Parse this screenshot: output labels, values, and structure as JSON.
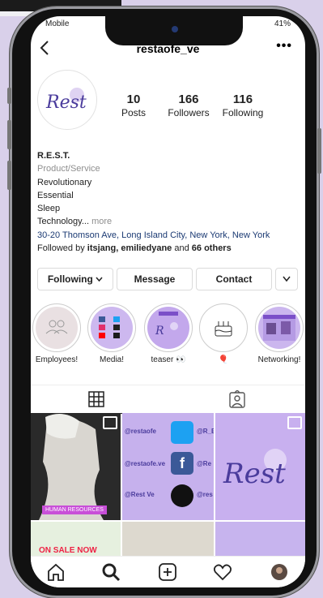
{
  "status": {
    "carrier": "Mobile",
    "battery": "41%"
  },
  "header": {
    "username": "restaofe_ve",
    "back_icon": "back-arrow-icon",
    "options_icon": "more-options-icon",
    "options_label": "•••"
  },
  "profile": {
    "logo_text": "Rest",
    "stats": [
      {
        "value": "10",
        "label": "Posts"
      },
      {
        "value": "166",
        "label": "Followers"
      },
      {
        "value": "116",
        "label": "Following"
      }
    ],
    "name": "R.E.S.T.",
    "category": "Product/Service",
    "bio_lines": [
      "Revolutionary",
      "Essential",
      "Sleep"
    ],
    "bio_truncated": "Technology...",
    "more_label": "more",
    "address": "30-20 Thomson Ave, Long Island City, New York, New York",
    "followed_prefix": "Followed by",
    "followed_names": "itsjang, emiliedyane",
    "followed_and": "and",
    "followed_others": "66 others"
  },
  "actions": {
    "following": "Following",
    "message": "Message",
    "contact": "Contact",
    "dropdown_icon": "chevron-down-icon"
  },
  "highlights": [
    {
      "label": "Employees!"
    },
    {
      "label": "Media!"
    },
    {
      "label": "teaser 👀"
    },
    {
      "label": "🎈"
    },
    {
      "label": "Networking!"
    }
  ],
  "tabs": {
    "grid_icon": "grid-icon",
    "tagged_icon": "tagged-icon"
  },
  "posts": {
    "hr_tag": "HUMAN RESOURCES",
    "social": [
      {
        "handle": "@restaofe",
        "handle2": "@R_E"
      },
      {
        "handle": "@restaofe.ve",
        "handle2": "@Re"
      },
      {
        "handle": "@Rest Ve",
        "handle2": "@res"
      }
    ],
    "on_sale": "ON SALE NOW",
    "grid_logo": "Rest"
  },
  "colors": {
    "accent_blue": "#1b3a73",
    "lavender": "#c9b5ea",
    "brand_purple": "#4a3b9c"
  }
}
